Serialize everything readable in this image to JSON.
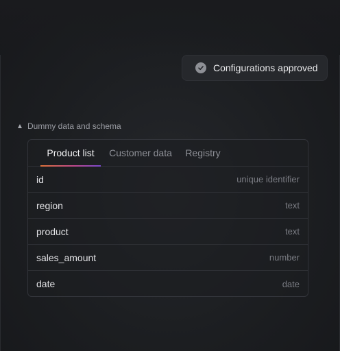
{
  "toast": {
    "message": "Configurations approved",
    "icon": "check-circle-icon"
  },
  "section": {
    "title": "Dummy data and schema",
    "expanded": true
  },
  "tabs": [
    {
      "label": "Product list",
      "active": true
    },
    {
      "label": "Customer data",
      "active": false
    },
    {
      "label": "Registry",
      "active": false
    }
  ],
  "schema": {
    "rows": [
      {
        "name": "id",
        "type": "unique identifier"
      },
      {
        "name": "region",
        "type": "text"
      },
      {
        "name": "product",
        "type": "text"
      },
      {
        "name": "sales_amount",
        "type": "number"
      },
      {
        "name": "date",
        "type": "date"
      }
    ]
  },
  "colors": {
    "tab_underline_start": "#e0733a",
    "tab_underline_mid": "#c34a8e",
    "tab_underline_end": "#7a4ad0"
  }
}
